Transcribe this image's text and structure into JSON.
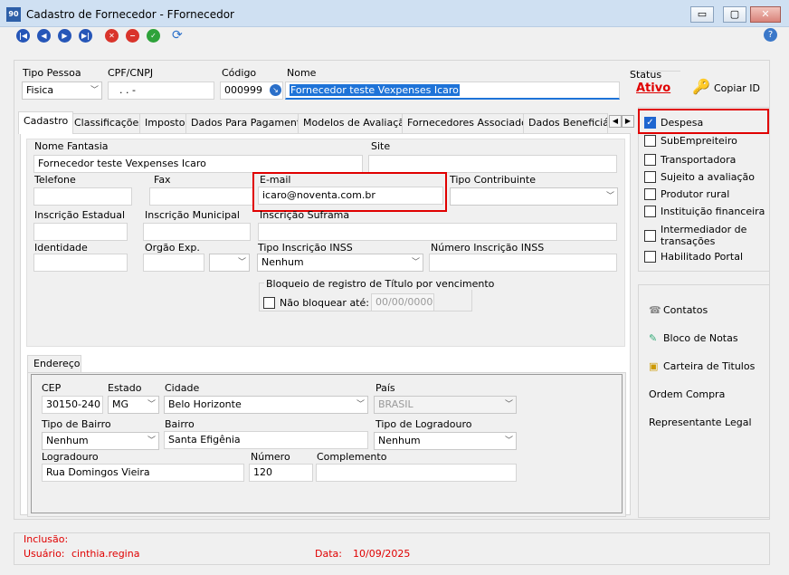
{
  "window": {
    "title": "Cadastro de Fornecedor - FFornecedor",
    "app_icon": "90",
    "minimize": "▭",
    "maximize": "▢",
    "close": "✕"
  },
  "toolbar": {
    "help": "?",
    "refresh": "⟳",
    "icons": [
      "first-icon",
      "prev-icon",
      "next-icon",
      "last-icon",
      "cancel-icon",
      "delete-icon",
      "confirm-icon",
      "refresh-icon",
      "help-icon"
    ]
  },
  "header": {
    "tipo_pessoa_label": "Tipo Pessoa",
    "tipo_pessoa_value": "Fisica",
    "cpf_label": "CPF/CNPJ",
    "cpf_value": ". . -",
    "codigo_label": "Código",
    "codigo_value": "000999",
    "nome_label": "Nome",
    "nome_value": "Fornecedor teste Vexpenses Icaro",
    "status_label": "Status",
    "status_value": "Ativo",
    "copy_label": "Copiar ID"
  },
  "tabs": [
    "Cadastro",
    "Classificações",
    "Imposto",
    "Dados Para Pagamento",
    "Modelos de Avaliação",
    "Fornecedores Associados",
    "Dados Beneficiáric"
  ],
  "cadastro": {
    "nome_fantasia_label": "Nome Fantasia",
    "nome_fantasia_value": "Fornecedor teste Vexpenses Icaro",
    "site_label": "Site",
    "site_value": "",
    "telefone_label": "Telefone",
    "fax_label": "Fax",
    "email_label": "E-mail",
    "email_value": "icaro@noventa.com.br",
    "tipo_contribuinte_label": "Tipo Contribuinte",
    "insc_estadual_label": "Inscrição Estadual",
    "insc_municipal_label": "Inscrição Municipal",
    "insc_suframa_label": "Inscrição Suframa",
    "identidade_label": "Identidade",
    "orgao_label": "Orgão Exp.",
    "tipo_inss_label": "Tipo Inscrição INSS",
    "tipo_inss_value": "Nenhum",
    "num_inss_label": "Número Inscrição INSS",
    "bloqueio_label": "Bloqueio de registro de Título por vencimento",
    "nao_bloquear_label": "Não bloquear até:",
    "nao_bloquear_date": "00/00/0000"
  },
  "endereco": {
    "tab_label": "Endereço",
    "cep_label": "CEP",
    "cep_value": "30150-240",
    "estado_label": "Estado",
    "estado_value": "MG",
    "cidade_label": "Cidade",
    "cidade_value": "Belo Horizonte",
    "pais_label": "País",
    "pais_value": "BRASIL",
    "tipo_bairro_label": "Tipo de Bairro",
    "tipo_bairro_value": "Nenhum",
    "bairro_label": "Bairro",
    "bairro_value": "Santa Efigênia",
    "tipo_logradouro_label": "Tipo de Logradouro",
    "tipo_logradouro_value": "Nenhum",
    "logradouro_label": "Logradouro",
    "logradouro_value": "Rua Domingos Vieira",
    "numero_label": "Número",
    "numero_value": "120",
    "complemento_label": "Complemento",
    "complemento_value": ""
  },
  "checks": [
    {
      "label": "Despesa",
      "checked": true
    },
    {
      "label": "SubEmpreiteiro",
      "checked": false
    },
    {
      "label": "Transportadora",
      "checked": false
    },
    {
      "label": "Sujeito a avaliação",
      "checked": false
    },
    {
      "label": "Produtor rural",
      "checked": false
    },
    {
      "label": "Instituição financeira",
      "checked": false
    },
    {
      "label": "Intermediador de transações",
      "checked": false
    },
    {
      "label": "Habilitado Portal",
      "checked": false
    }
  ],
  "actions": [
    "Contatos",
    "Bloco de Notas",
    "Carteira de Titulos",
    "Ordem Compra",
    "Representante Legal"
  ],
  "footer": {
    "inclusao_label": "Inclusão:",
    "usuario_label": "Usuário:",
    "usuario_value": "cinthia.regina",
    "data_label": "Data:",
    "data_value": "10/09/2025"
  },
  "colors": {
    "highlight": "#e00000",
    "selection": "#1e73d8",
    "status": "#e00000"
  }
}
